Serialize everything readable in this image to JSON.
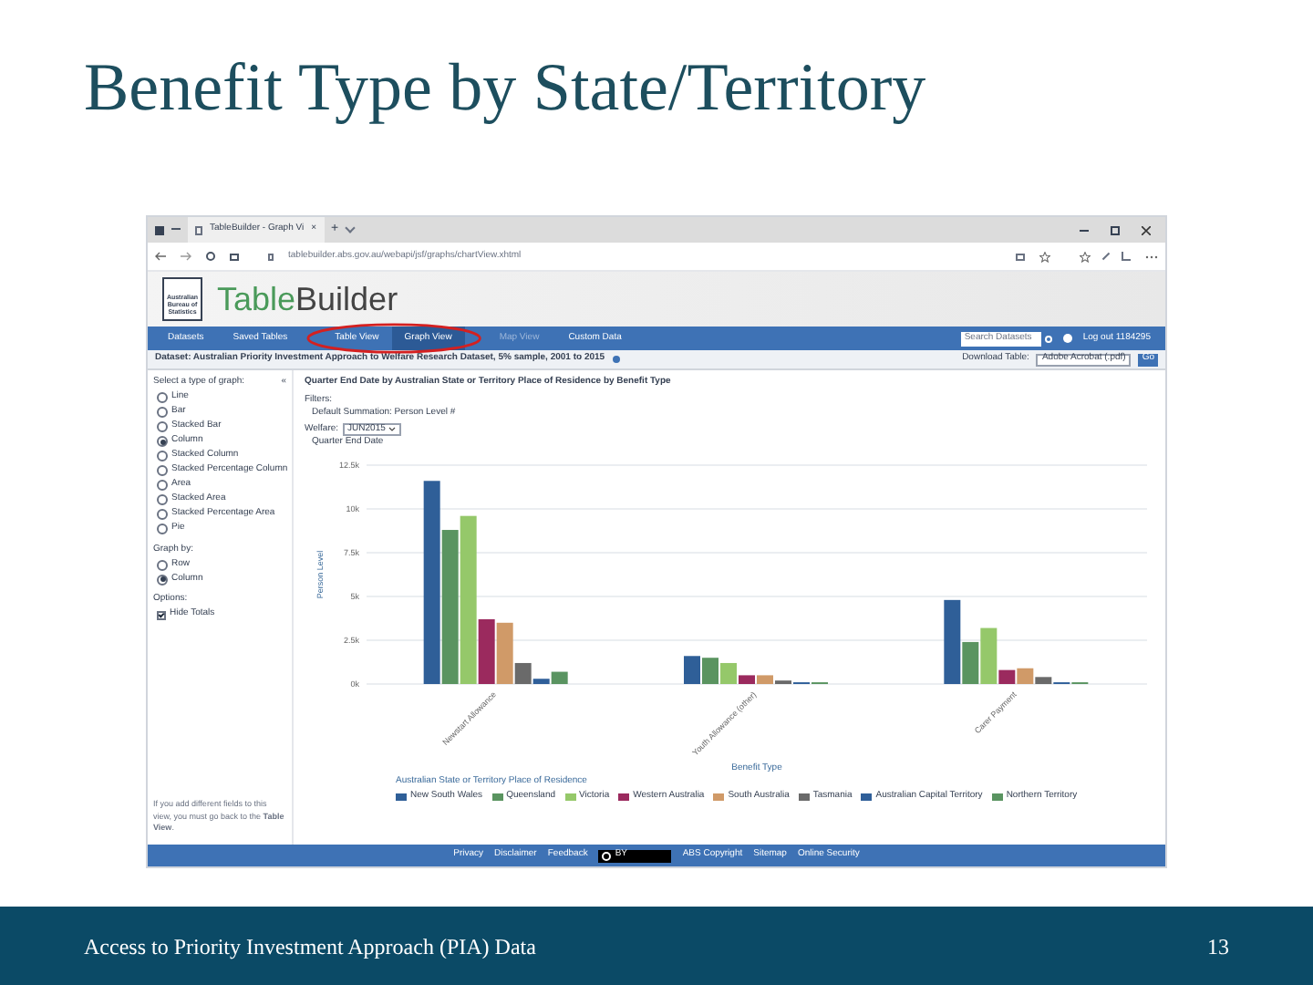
{
  "slide": {
    "title": "Benefit Type by State/Territory",
    "footer_text": "Access to Priority Investment Approach (PIA) Data",
    "page_number": "13"
  },
  "browser": {
    "tab_title": "TableBuilder - Graph Vi",
    "tab_close": "×",
    "new_tab": "+",
    "url": "tablebuilder.abs.gov.au/webapi/jsf/graphs/chartView.xhtml"
  },
  "app": {
    "logo_text": "Australian Bureau of Statistics",
    "brand_part1": "Table",
    "brand_part2": "Builder",
    "nav": [
      {
        "label": "Datasets",
        "selected": false,
        "disabled": false,
        "highlighted": false
      },
      {
        "label": "Saved Tables",
        "selected": false,
        "disabled": false,
        "highlighted": false
      },
      {
        "label": "Table View",
        "selected": false,
        "disabled": false,
        "highlighted": true
      },
      {
        "label": "Graph View",
        "selected": true,
        "disabled": false,
        "highlighted": true
      },
      {
        "label": "Map View",
        "selected": false,
        "disabled": true,
        "highlighted": false
      },
      {
        "label": "Custom Data",
        "selected": false,
        "disabled": false,
        "highlighted": false
      }
    ],
    "search": {
      "placeholder": "Search Datasets"
    },
    "logout": "Log out 1184295",
    "dataset": "Dataset: Australian Priority Investment Approach to Welfare Research Dataset, 5% sample, 2001 to 2015",
    "download_label": "Download Table:",
    "download_format": "Adobe Acrobat (.pdf)",
    "go": "Go"
  },
  "graph_panel": {
    "type_heading": "Select a type of graph:",
    "collapse": "«",
    "types": [
      {
        "label": "Line",
        "selected": false
      },
      {
        "label": "Bar",
        "selected": false
      },
      {
        "label": "Stacked Bar",
        "selected": false
      },
      {
        "label": "Column",
        "selected": true
      },
      {
        "label": "Stacked Column",
        "selected": false
      },
      {
        "label": "Stacked Percentage Column",
        "selected": false
      },
      {
        "label": "Area",
        "selected": false
      },
      {
        "label": "Stacked Area",
        "selected": false
      },
      {
        "label": "Stacked Percentage Area",
        "selected": false
      },
      {
        "label": "Pie",
        "selected": false
      }
    ],
    "graph_by_heading": "Graph by:",
    "graph_by": [
      {
        "label": "Row",
        "selected": false
      },
      {
        "label": "Column",
        "selected": true
      }
    ],
    "options_heading": "Options:",
    "options": [
      {
        "label": "Hide Totals",
        "checked": true
      }
    ],
    "note": "If you add different fields to this view, you must go back to the **Table View**."
  },
  "graph": {
    "heading": "Quarter End Date by Australian State or Territory Place of Residence by Benefit Type",
    "filters_label": "Filters:",
    "filter": "Default Summation: Person Level #",
    "wafer_label": "Welfare:",
    "wafer_value": "JUN2015",
    "wafer_sub": "Quarter End Date",
    "legend_title": "Australian State or Territory Place of Residence",
    "chart_data": {
      "type": "bar",
      "xlabel": "Benefit Type",
      "ylabel": "Person Level",
      "grid": true,
      "categories": [
        "Newstart Allowance",
        "Youth Allowance (other)",
        "Carer Payment"
      ],
      "yticks": [
        {
          "value": 0,
          "label": "0k"
        },
        {
          "value": 2500,
          "label": "2.5k"
        },
        {
          "value": 5000,
          "label": "5k"
        },
        {
          "value": 7500,
          "label": "7.5k"
        },
        {
          "value": 10000,
          "label": "10k"
        },
        {
          "value": 12500,
          "label": "12.5k"
        }
      ],
      "ylim": [
        0,
        12500
      ],
      "series": [
        {
          "name": "New South Wales",
          "color": "#2f5f98",
          "values": [
            11600,
            1600,
            4800
          ]
        },
        {
          "name": "Queensland",
          "color": "#5a9460",
          "values": [
            8800,
            1500,
            2400
          ]
        },
        {
          "name": "Victoria",
          "color": "#95c86a",
          "values": [
            9600,
            1200,
            3200
          ]
        },
        {
          "name": "Western Australia",
          "color": "#9b2a5e",
          "values": [
            3700,
            500,
            800
          ]
        },
        {
          "name": "South Australia",
          "color": "#d09a68",
          "values": [
            3500,
            500,
            900
          ]
        },
        {
          "name": "Tasmania",
          "color": "#6a6a6a",
          "values": [
            1200,
            200,
            400
          ]
        },
        {
          "name": "Australian Capital Territory",
          "color": "#2f5f99",
          "values": [
            300,
            100,
            100
          ]
        },
        {
          "name": "Northern Territory",
          "color": "#5a9461",
          "values": [
            700,
            100,
            100
          ]
        }
      ]
    }
  },
  "footer_links": [
    "Privacy",
    "Disclaimer",
    "Feedback",
    "ABS Copyright",
    "Sitemap",
    "Online Security"
  ],
  "license": "BY"
}
